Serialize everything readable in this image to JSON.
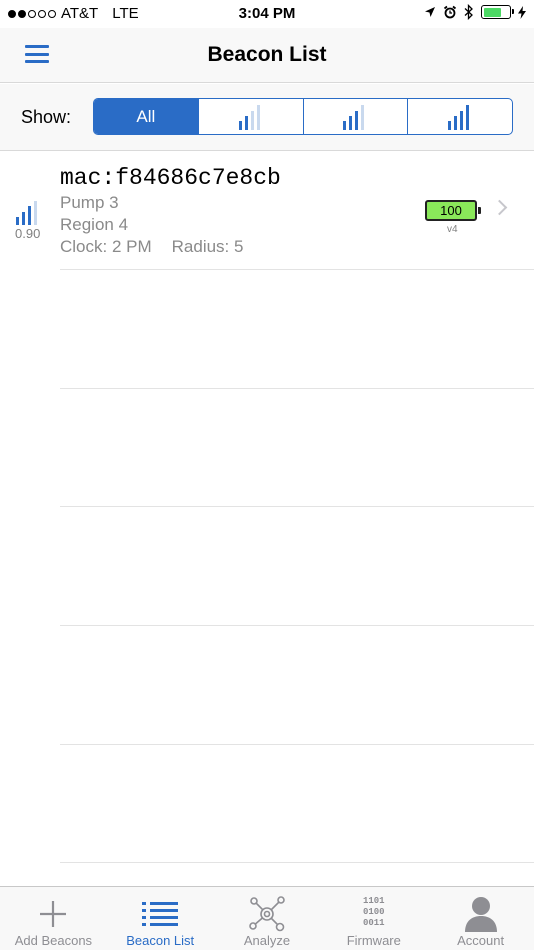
{
  "status_bar": {
    "carrier": "AT&T",
    "network": "LTE",
    "time": "3:04 PM"
  },
  "nav": {
    "title": "Beacon List"
  },
  "filter": {
    "label": "Show:",
    "segments": [
      {
        "label": "All",
        "icon": "signal-any-icon",
        "active": true
      },
      {
        "label": "",
        "icon": "signal-weak-icon",
        "active": false
      },
      {
        "label": "",
        "icon": "signal-medium-icon",
        "active": false
      },
      {
        "label": "",
        "icon": "signal-strong-icon",
        "active": false
      }
    ]
  },
  "beacons": [
    {
      "mac": "mac:f84686c7e8cb",
      "name": "Pump 3",
      "region": "Region 4",
      "clock": "Clock: 2 PM",
      "radius": "Radius: 5",
      "rssi": "0.90",
      "battery": "100",
      "firmware": "v4"
    }
  ],
  "tabs": [
    {
      "label": "Add Beacons",
      "icon": "plus-icon",
      "active": false
    },
    {
      "label": "Beacon List",
      "icon": "list-icon",
      "active": true
    },
    {
      "label": "Analyze",
      "icon": "network-icon",
      "active": false
    },
    {
      "label": "Firmware",
      "icon": "binary-icon",
      "active": false,
      "glyph_lines": [
        "1101",
        "0100",
        "0011"
      ]
    },
    {
      "label": "Account",
      "icon": "person-icon",
      "active": false
    }
  ],
  "colors": {
    "accent": "#2a6cc6",
    "battery_fill": "#8ae85a",
    "secondary_text": "#8a8a8a"
  }
}
